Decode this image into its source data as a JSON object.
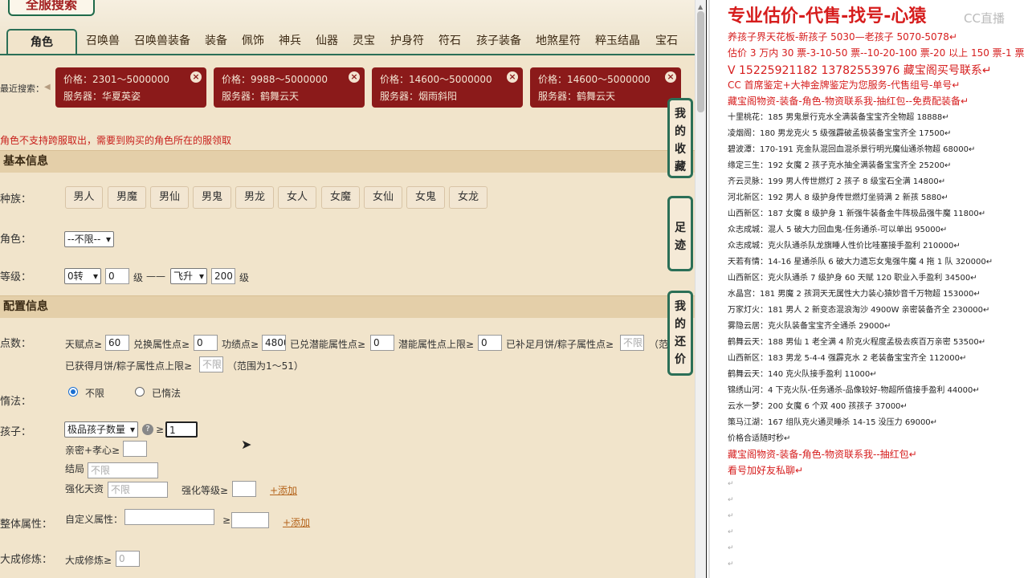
{
  "app": {
    "logo": "全服搜索"
  },
  "tabs": [
    "角色",
    "召唤兽",
    "召唤兽装备",
    "装备",
    "佩饰",
    "神兵",
    "仙器",
    "灵宝",
    "护身符",
    "符石",
    "孩子装备",
    "地煞星符",
    "粹玉结晶",
    "宝石"
  ],
  "recent": {
    "label": "最近搜索：",
    "cards": [
      {
        "price": "价格：2301～5000000",
        "server": "服务器：华夏英姿"
      },
      {
        "price": "价格：9988～5000000",
        "server": "服务器：鹤舞云天"
      },
      {
        "price": "价格：14600～5000000",
        "server": "服务器：烟雨斜阳"
      },
      {
        "price": "价格：14600～5000000",
        "server": "服务器：鹤舞云天"
      }
    ]
  },
  "notice": "角色不支持跨服取出，需要到购买的角色所在的服领取",
  "sections": {
    "basic": "基本信息",
    "config": "配置信息"
  },
  "basic": {
    "race_label": "种族：",
    "races": [
      "男人",
      "男魔",
      "男仙",
      "男鬼",
      "男龙",
      "女人",
      "女魔",
      "女仙",
      "女鬼",
      "女龙"
    ],
    "role_label": "角色：",
    "role_value": "--不限--",
    "level_label": "等级：",
    "level_from_sel": "0转",
    "level_from": "0",
    "level_unit": "级",
    "dash": "——",
    "level_to_sel": "飞升",
    "level_to": "200",
    "level_unit2": "级"
  },
  "config": {
    "points_label": "点数：",
    "talent_label": "天赋点≥",
    "talent_value": "60",
    "exchange_label": "兑换属性点≥",
    "exchange_value": "0",
    "merit_label": "功绩点≥",
    "merit_value": "4800",
    "potential_label": "已兑潜能属性点≥",
    "potential_value": "0",
    "potential_max_label": "潜能属性点上限≥",
    "potential_max_value": "0",
    "mooncake_label": "已补足月饼/粽子属性点≥",
    "mooncake_placeholder": "不限",
    "range_cut": "（范",
    "mooncake_max_label": "已获得月饼/粽子属性点上限≥",
    "mooncake_max_placeholder": "不限",
    "range_text": "（范围为1～51）",
    "inertia_label": "惰法：",
    "inertia_opt1": "不限",
    "inertia_opt2": "已惰法",
    "child_label": "孩子：",
    "child_select": "极品孩子数量",
    "ge": "≥",
    "child_value": "1",
    "intimacy_label": "亲密+孝心≥",
    "ending_label": "结局",
    "ending_placeholder": "不限",
    "talent2_label": "强化天资",
    "talent2_placeholder": "不限",
    "enhance_label": "强化等级≥",
    "add_label": "+添加",
    "overall_label": "整体属性：",
    "custom_label": "自定义属性：",
    "mastery_label": "大成修炼：",
    "mastery_label2": "大成修炼≥",
    "mastery_value": "0"
  },
  "side_buttons": [
    "我的收藏",
    "足迹",
    "我的还价"
  ],
  "doc": {
    "watermark": "CC直播",
    "title": "专业估价-代售-找号-心猿",
    "lines": [
      {
        "t": "养孩子界天花板-新孩子 5030—老孩子 5070-5078↵",
        "c": "red"
      },
      {
        "t": "估价 3 万内 30 票-3-10-50 票--10-20-100 票-20 以上 150 票-1 票 1 元↵",
        "c": "red"
      },
      {
        "t": "V 15225921182     13782553976    藏宝阁买号联系↵",
        "c": "redbig"
      },
      {
        "t": "CC 首席鉴定+大神金牌鉴定为您服务-代售组号-单号↵",
        "c": "red"
      },
      {
        "t": "藏宝阁物资-装备-角色-物资联系我-抽红包--免费配装备↵",
        "c": "red"
      },
      {
        "t": "十里桃花：185 男鬼景行克水全满装备宝宝齐全物超 18888↵",
        "c": ""
      },
      {
        "t": "凌烟阁：180 男龙克火 5 级强霹破孟极装备宝宝齐全 17500↵",
        "c": ""
      },
      {
        "t": "碧波潭：170-191 克金队混回血混杀景行明光魔仙通杀物超 68000↵",
        "c": ""
      },
      {
        "t": "缘定三生：192 女魔 2 孩子克水抽全满装备宝宝齐全 25200↵",
        "c": ""
      },
      {
        "t": "齐云灵脉：199 男人传世燃灯 2 孩子 8 级宝石全满 14800↵",
        "c": ""
      },
      {
        "t": "河北新区：192 男人 8 级护身传世燃灯坐骑满 2 新孩 5880↵",
        "c": ""
      },
      {
        "t": "山西新区：187 女魔 8 级护身 1 新强牛装备金牛阵极品强牛魔 11800↵",
        "c": ""
      },
      {
        "t": "众志成城：混人 5 破大力回血鬼-任务通杀-可以单出 95000↵",
        "c": ""
      },
      {
        "t": "众志成城：克火队通杀队龙旗睡人性价比哇塞接手盈利 210000↵",
        "c": ""
      },
      {
        "t": "天若有情：14-16 星通杀队 6 破大力遗忘女鬼强牛魔 4 拖 1 队 320000↵",
        "c": ""
      },
      {
        "t": "山西新区：克火队通杀 7 级护身 60 天赋 120 职业入手盈利 34500↵",
        "c": ""
      },
      {
        "t": "水晶宫：181 男魔 2 孩洞天无属性大力装心猿妙音千万物超 153000↵",
        "c": ""
      },
      {
        "t": "万家灯火：181 男人 2 新变态混浪淘沙 4900W 亲密装备齐全 230000↵",
        "c": ""
      },
      {
        "t": "雾隐云居：克火队装备宝宝齐全通杀 29000↵",
        "c": ""
      },
      {
        "t": "鹤舞云天：188 男仙 1 老全满 4 阶克火程度孟极去疾百万亲密 53500↵",
        "c": ""
      },
      {
        "t": "山西新区：183 男龙 5-4-4 强霹克水 2 老装备宝宝齐全 112000↵",
        "c": ""
      },
      {
        "t": "鹤舞云天：140 克火队接手盈利 11000↵",
        "c": ""
      },
      {
        "t": "锦绣山河：4 下克火队-任务通杀-品像较好-物超所值接手盈利 44000↵",
        "c": ""
      },
      {
        "t": "云水一梦：200 女魔 6 个双 400 孩孩子 37000↵",
        "c": ""
      },
      {
        "t": "策马江湖：167 组队克火通灵睡杀 14-15 没压力 69000↵",
        "c": ""
      },
      {
        "t": "价格合适随时秒↵",
        "c": ""
      },
      {
        "t": "藏宝阁物资-装备-角色-物资联系我--抽红包↵",
        "c": "red"
      },
      {
        "t": "看号加好友私聊↵",
        "c": "red"
      }
    ],
    "returns": [
      "↵",
      "↵",
      "↵",
      "↵",
      "↵",
      "↵"
    ]
  },
  "colors": {
    "accent": "#2b6f57",
    "card": "#8b1a1a",
    "red": "#d61d1d"
  }
}
